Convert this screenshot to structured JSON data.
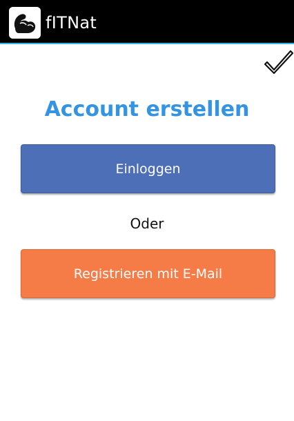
{
  "action_bar": {
    "title": "fITNat",
    "logo_icon": "flexing-arm-icon",
    "background": "#000000",
    "underline_color": "#33b5e5"
  },
  "toolbar": {
    "confirm_icon": "checkmark-icon"
  },
  "main": {
    "title": "Account erstellen",
    "title_color": "#3494e2",
    "login_label": "Einloggen",
    "login_color": "#4d6fb8",
    "separator_label": "Oder",
    "register_label": "Registrieren mit E-Mail",
    "register_color": "#f67c47"
  }
}
